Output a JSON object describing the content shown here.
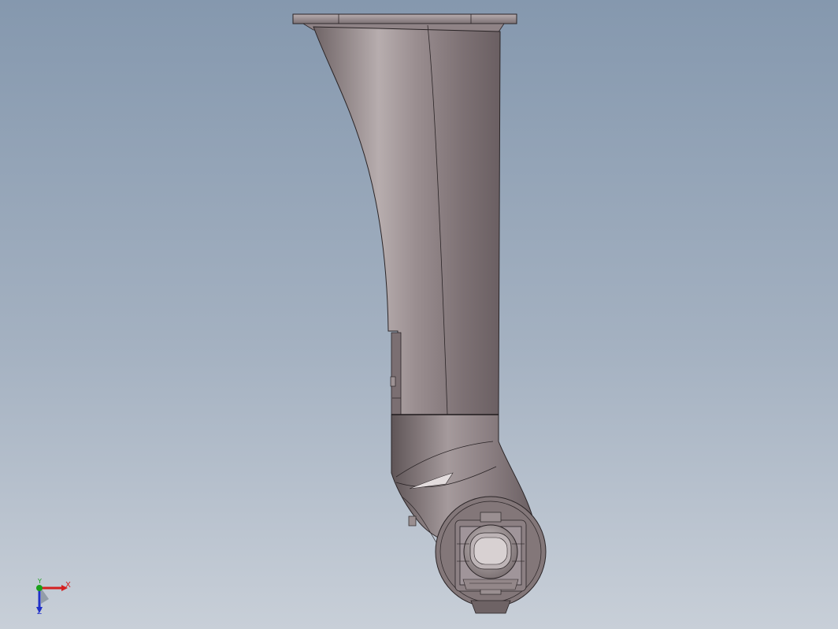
{
  "viewport": {
    "background_top": "#8598ae",
    "background_bottom": "#c8cfd8",
    "model_color": "#8d8184"
  },
  "triad": {
    "x_label": "X",
    "y_label": "Y",
    "z_label": "Z",
    "x_color": "#d42020",
    "y_color": "#1aa01a",
    "z_color": "#2030c8"
  }
}
